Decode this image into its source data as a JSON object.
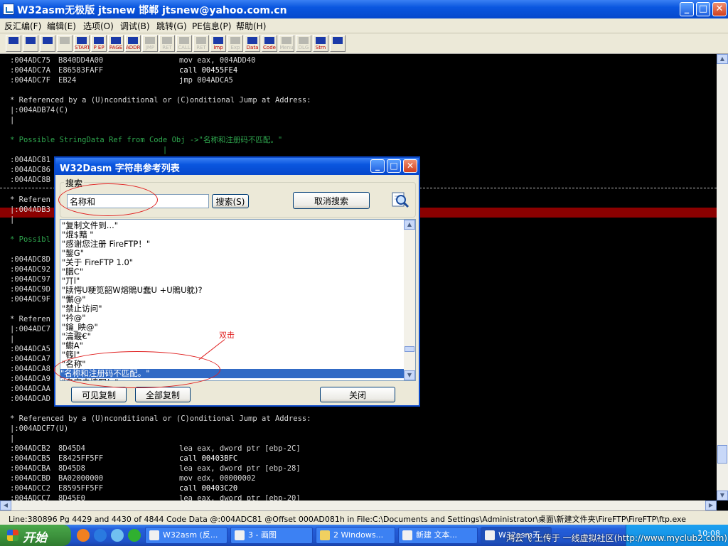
{
  "window": {
    "title": "W32asm无极版 jtsnew 邯郸  jtsnew@yahoo.com.cn",
    "minimize": "_",
    "maximize": "□",
    "close": "✕"
  },
  "menu": [
    "反汇编(F)",
    "编辑(E)",
    "选项(O)",
    "调试(B)",
    "跳转(G)",
    "PE信息(P)",
    "帮助(H)"
  ],
  "toolbar": [
    {
      "label": "",
      "dim": false,
      "icon": "folder-open-icon"
    },
    {
      "label": "",
      "dim": false,
      "icon": "save-icon"
    },
    {
      "label": "",
      "dim": false,
      "icon": "pen-icon"
    },
    {
      "label": "",
      "dim": true,
      "icon": "goto-icon"
    },
    {
      "label": "START",
      "dim": false,
      "icon": "start-icon"
    },
    {
      "label": "P EP",
      "dim": false,
      "icon": "entry-point-icon"
    },
    {
      "label": "PAGE",
      "dim": false,
      "icon": "page-icon"
    },
    {
      "label": "ADDR",
      "dim": false,
      "icon": "address-icon"
    },
    {
      "label": "JMP",
      "dim": true,
      "icon": "jump-icon"
    },
    {
      "label": "RET",
      "dim": true,
      "icon": "return-icon"
    },
    {
      "label": "CALL",
      "dim": true,
      "icon": "call-icon"
    },
    {
      "label": "RET",
      "dim": true,
      "icon": "return-icon"
    },
    {
      "label": "Imp Fn",
      "dim": false,
      "icon": "import-icon"
    },
    {
      "label": "Exp Fn",
      "dim": true,
      "icon": "export-icon"
    },
    {
      "label": "Data Hex",
      "dim": false,
      "icon": "data-hex-icon"
    },
    {
      "label": "Code Hex",
      "dim": false,
      "icon": "code-hex-icon"
    },
    {
      "label": "Menu REF",
      "dim": true,
      "icon": "menu-ref-icon"
    },
    {
      "label": "DLG REF",
      "dim": true,
      "icon": "dialog-ref-icon"
    },
    {
      "label": "Strn REF",
      "dim": false,
      "icon": "string-ref-icon"
    },
    {
      "label": "",
      "dim": false,
      "icon": "print-icon"
    }
  ],
  "code_lines": [
    {
      "addr": ":004ADC75",
      "hex": "B840DD4A00",
      "asm": "mov eax, 004ADD40",
      "kind": "code"
    },
    {
      "addr": ":004ADC7A",
      "hex": "E86583FAFF",
      "asm": "call 00455FE4",
      "kind": "call"
    },
    {
      "addr": ":004ADC7F",
      "hex": "EB24",
      "asm": "jmp 004ADCA5",
      "kind": "code"
    },
    {
      "text": "",
      "kind": "blank"
    },
    {
      "text": "* Referenced by a (U)nconditional or (C)onditional Jump at Address:",
      "kind": "comment"
    },
    {
      "text": "|:004ADB74(C)",
      "kind": "comment"
    },
    {
      "text": "|",
      "kind": "comment"
    },
    {
      "text": "",
      "kind": "blank"
    },
    {
      "text": "* Possible StringData Ref from Code Obj ->\"名称和注册码不匹配。\"",
      "kind": "string"
    },
    {
      "text": "                                  |",
      "kind": "string"
    },
    {
      "addr": ":004ADC81",
      "hex": "",
      "asm": "",
      "kind": "selected"
    },
    {
      "addr": ":004ADC86",
      "hex": "",
      "asm": "",
      "kind": "code"
    },
    {
      "addr": ":004ADC8B",
      "hex": "",
      "asm": "",
      "kind": "code"
    },
    {
      "text": "",
      "kind": "blank"
    },
    {
      "text": "* Referen",
      "kind": "comment"
    },
    {
      "text": "|:004ADB3",
      "kind": "comment"
    },
    {
      "text": "|",
      "kind": "comment"
    },
    {
      "text": "",
      "kind": "blank"
    },
    {
      "text": "* Possibl",
      "kind": "string"
    },
    {
      "text": "",
      "kind": "blank"
    },
    {
      "addr": ":004ADC8D",
      "hex": "",
      "asm": "",
      "kind": "code"
    },
    {
      "addr": ":004ADC92",
      "hex": "",
      "asm": "",
      "kind": "code"
    },
    {
      "addr": ":004ADC97",
      "hex": "",
      "asm": "",
      "kind": "code"
    },
    {
      "addr": ":004ADC9D",
      "hex": "",
      "asm": "",
      "kind": "code"
    },
    {
      "addr": ":004ADC9F",
      "hex": "",
      "asm": "",
      "kind": "code"
    },
    {
      "text": "",
      "kind": "blank"
    },
    {
      "text": "* Referen",
      "kind": "comment"
    },
    {
      "text": "|:004ADC7",
      "kind": "comment"
    },
    {
      "text": "|",
      "kind": "comment"
    },
    {
      "addr": ":004ADCA5",
      "hex": "",
      "asm": "",
      "kind": "code"
    },
    {
      "addr": ":004ADCA7",
      "hex": "",
      "asm": "",
      "kind": "code"
    },
    {
      "addr": ":004ADCA8",
      "hex": "",
      "asm": "",
      "kind": "code"
    },
    {
      "addr": ":004ADCA9",
      "hex": "",
      "asm": "",
      "kind": "code"
    },
    {
      "addr": ":004ADCAA",
      "hex": "",
      "asm": "",
      "kind": "code"
    },
    {
      "addr": ":004ADCAD",
      "hex": "",
      "asm": "",
      "kind": "code"
    },
    {
      "text": "",
      "kind": "blank"
    },
    {
      "text": "* Referenced by a (U)nconditional or (C)onditional Jump at Address:",
      "kind": "comment"
    },
    {
      "text": "|:004ADCF7(U)",
      "kind": "comment"
    },
    {
      "text": "|",
      "kind": "comment"
    },
    {
      "addr": ":004ADCB2",
      "hex": "8D45D4",
      "asm": "lea eax, dword ptr [ebp-2C]",
      "kind": "code"
    },
    {
      "addr": ":004ADCB5",
      "hex": "E8425FF5FF",
      "asm": "call 00403BFC",
      "kind": "call"
    },
    {
      "addr": ":004ADCBA",
      "hex": "8D45D8",
      "asm": "lea eax, dword ptr [ebp-28]",
      "kind": "code"
    },
    {
      "addr": ":004ADCBD",
      "hex": "BA02000000",
      "asm": "mov edx, 00000002",
      "kind": "code"
    },
    {
      "addr": ":004ADCC2",
      "hex": "E8595FF5FF",
      "asm": "call 00403C20",
      "kind": "call"
    },
    {
      "addr": ":004ADCC7",
      "hex": "8D45E0",
      "asm": "lea eax, dword ptr [ebp-20]",
      "kind": "code"
    }
  ],
  "statusbar": {
    "text": "Line:380896 Pg 4429 and 4430 of 4844  Code Data @:004ADC81 @Offset 000AD081h in File:C:\\Documents and Settings\\Administrator\\桌面\\新建文件夹\\FireFTP\\FireFTP\\ftp.exe"
  },
  "taskbar": {
    "start_label": "开始",
    "tasks": [
      "W32asm (反...",
      "3 - 画图",
      "2 Windows...",
      "新建 文本...",
      "W32asm无..."
    ],
    "clock": "10:08"
  },
  "watermark": "鸿云飞 上传于 一线虚拟社区(http://www.myclub2.com)",
  "dialog": {
    "title": "W32Dasm 字符串参考列表",
    "group_label": "搜索",
    "search_value": "名称和",
    "search_button": "搜索(S)",
    "cancel_search_button": "取消搜索",
    "strings": [
      "\"复制文件到...\"",
      "\"焜$黯   \"",
      "\"感谢您注册 FireFTP！\"",
      "\"鏊G\"",
      "\"关于 FireFTP 1.0\"",
      "\"胭C\"",
      "\"丌l\"",
      "\"牍愕U粳笕韶W熔鵙U蠢U +U鵙U躭)?",
      "\"懈@\"",
      "\"禁止访问\"",
      "\"衿@\"",
      "\"鑰_眏@\"",
      "\"瀹霰€\"",
      "\"鳚A\"",
      "\"篯l\"",
      "\"名称\"",
      "\"名称和注册码不匹配。\"",
      "\"名字未填写！\""
    ],
    "selected_index": 16,
    "copy_visible_button": "可见复制",
    "copy_all_button": "全部复制",
    "close_button": "关闭"
  },
  "annotation": {
    "text": "双击",
    "color": "#e02020"
  },
  "colors": {
    "selection_line": "#8b0000",
    "string_ref": "#2fa84f",
    "list_selection": "#316ac5"
  }
}
